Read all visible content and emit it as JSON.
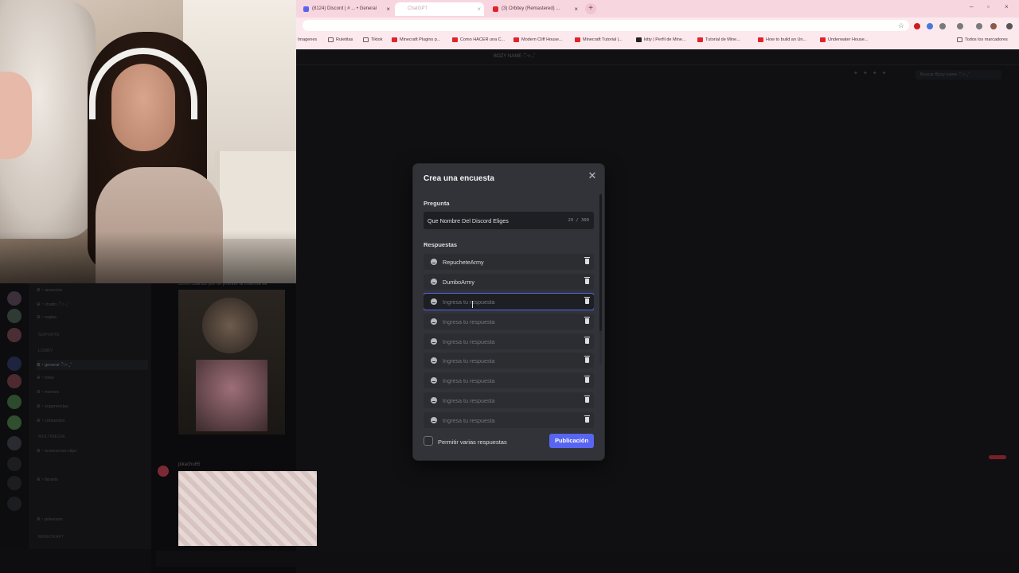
{
  "browser": {
    "tabs": [
      {
        "label": "(8124) Discord | # ... • General",
        "active": false
      },
      {
        "label": "ChatGPT",
        "active": true
      },
      {
        "label": "(3) Orbitey (Remastered) ...",
        "active": false
      }
    ],
    "bookmarks": [
      "Imagenes",
      "Ruletitas",
      "Tiktok",
      "Minecraft Plugins p...",
      "Como HACER una C...",
      "Modern Cliff House...",
      "Minecraft Tutorial |...",
      "kitty | Perfil de Mine...",
      "Tutorial de Mine...",
      "How to build an Un...",
      "Underwater House...",
      "Todos los marcadores"
    ],
    "colors": {
      "tabstrip": "#f7d6df",
      "toolbar": "#fbe9ee"
    }
  },
  "discord": {
    "channel_header": "BOZY NAME ੈ✩‧₊˚",
    "search_placeholder": "Buscar Bozy name ੈ✩‧₊˚",
    "categories": [
      "SOPORTE",
      "LOBBY",
      "MULTIMEDIA",
      "MINECRAFT"
    ],
    "channels": [
      "ꕤ・anuncios",
      "ꕤ・chatto ੈ✩‧₊˚",
      "ꕤ・reglas",
      "ꕤ・general ੈ✩‧₊˚",
      "ꕤ・fotos",
      "ꕤ・memes",
      "ꕤ・sugerencias",
      "ꕤ・comandos",
      "ꕤ・ensena-tus-clips",
      "ꕤ・fanarts",
      "ꕤ・pokemon"
    ],
    "selected_channel": "ꕤ・general ੈ✩‧₊˚",
    "message_snippet": "como cuando por fin prende la chamita ak",
    "message_author": "pikachu65"
  },
  "poll_modal": {
    "title": "Crea una encuesta",
    "question_label": "Pregunta",
    "question_value": "Que Nombre Del Discord Eliges",
    "question_counter": "29 / 300",
    "answers_label": "Respuestas",
    "answers": [
      {
        "value": "RepucheteArmy",
        "placeholder": "Ingresa tu respuesta"
      },
      {
        "value": "DumboArmy",
        "placeholder": "Ingresa tu respuesta"
      },
      {
        "value": "",
        "placeholder": "Ingresa tu respuesta",
        "focused": true
      },
      {
        "value": "",
        "placeholder": "Ingresa tu respuesta"
      },
      {
        "value": "",
        "placeholder": "Ingresa tu respuesta"
      },
      {
        "value": "",
        "placeholder": "Ingresa tu respuesta"
      },
      {
        "value": "",
        "placeholder": "Ingresa tu respuesta"
      },
      {
        "value": "",
        "placeholder": "Ingresa tu respuesta"
      },
      {
        "value": "",
        "placeholder": "Ingresa tu respuesta"
      }
    ],
    "multi_answer_label": "Permitir varias respuestas",
    "multi_answer_checked": false,
    "publish_label": "Publicación",
    "colors": {
      "modal_bg": "#313338",
      "input_bg": "#1e1f22",
      "accent": "#5865f2"
    }
  }
}
